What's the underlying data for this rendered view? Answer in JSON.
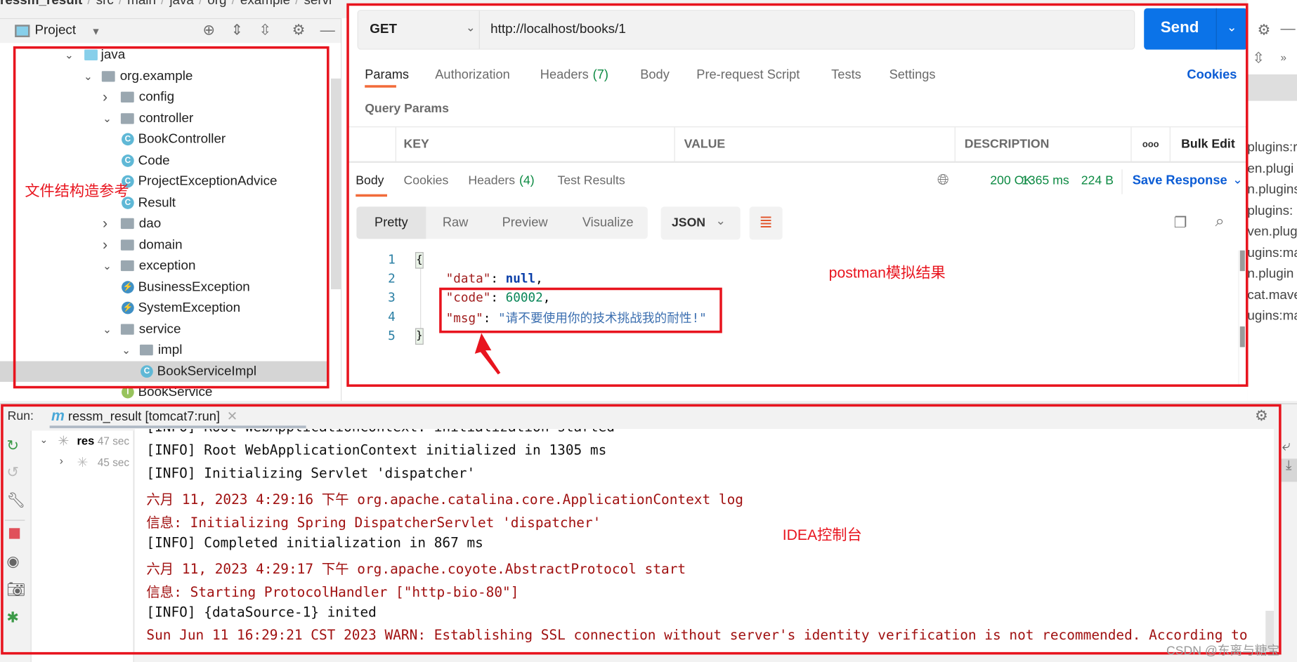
{
  "breadcrumb": [
    "ressm_result",
    "src",
    "main",
    "java",
    "org",
    "example",
    "servi"
  ],
  "project_panel": {
    "title": "Project",
    "tree": [
      {
        "label": "java",
        "type": "source-folder",
        "expanded": true
      },
      {
        "label": "org.example",
        "type": "package",
        "expanded": true
      },
      {
        "label": "config",
        "type": "package",
        "expanded": false
      },
      {
        "label": "controller",
        "type": "package",
        "expanded": true
      },
      {
        "label": "BookController",
        "type": "class"
      },
      {
        "label": "Code",
        "type": "class"
      },
      {
        "label": "ProjectExceptionAdvice",
        "type": "class"
      },
      {
        "label": "Result",
        "type": "class"
      },
      {
        "label": "dao",
        "type": "package",
        "expanded": false
      },
      {
        "label": "domain",
        "type": "package",
        "expanded": false
      },
      {
        "label": "exception",
        "type": "package",
        "expanded": true
      },
      {
        "label": "BusinessException",
        "type": "exception"
      },
      {
        "label": "SystemException",
        "type": "exception"
      },
      {
        "label": "service",
        "type": "package",
        "expanded": true
      },
      {
        "label": "impl",
        "type": "package",
        "expanded": true
      },
      {
        "label": "BookServiceImpl",
        "type": "class",
        "selected": true
      },
      {
        "label": "BookService",
        "type": "interface"
      }
    ]
  },
  "annotations": {
    "tree_note": "文件结构造参考",
    "postman_note": "postman模拟结果",
    "console_note": "IDEA控制台"
  },
  "postman": {
    "method": "GET",
    "url": "http://localhost/books/1",
    "send_label": "Send",
    "request_tabs": [
      {
        "label": "Params",
        "active": true
      },
      {
        "label": "Authorization"
      },
      {
        "label": "Headers",
        "count": "(7)"
      },
      {
        "label": "Body"
      },
      {
        "label": "Pre-request Script"
      },
      {
        "label": "Tests"
      },
      {
        "label": "Settings"
      }
    ],
    "cookies_link": "Cookies",
    "query_params_title": "Query Params",
    "table_headers": {
      "key": "KEY",
      "value": "VALUE",
      "description": "DESCRIPTION",
      "more": "ooo",
      "bulk_edit": "Bulk Edit"
    },
    "response_tabs": [
      {
        "label": "Body",
        "active": true
      },
      {
        "label": "Cookies"
      },
      {
        "label": "Headers",
        "count": "(4)"
      },
      {
        "label": "Test Results"
      }
    ],
    "status": "200 OK",
    "time": "1365 ms",
    "size": "224 B",
    "save_response": "Save Response",
    "view_modes": [
      "Pretty",
      "Raw",
      "Preview",
      "Visualize"
    ],
    "format": "JSON",
    "response_lines": [
      {
        "n": "1",
        "text": "{"
      },
      {
        "n": "2",
        "key": "\"data\"",
        "value": "null",
        "comma": ","
      },
      {
        "n": "3",
        "key": "\"code\"",
        "value": "60002",
        "comma": ","
      },
      {
        "n": "4",
        "key": "\"msg\"",
        "value": "\"请不要使用你的技术挑战我的耐性!\"",
        "comma": ""
      },
      {
        "n": "5",
        "text": "}"
      }
    ]
  },
  "right_strip_text": [
    "plugins:r",
    "en.plugi",
    "n.plugins",
    "plugins:",
    "ven.plug",
    "ugins:ma",
    "n.plugin",
    "cat.mave",
    "ugins:ma"
  ],
  "run_panel": {
    "label": "Run:",
    "tab": "ressm_result [tomcat7:run]",
    "tree": [
      {
        "name": "res",
        "time": "47 sec"
      },
      {
        "time": "45 sec"
      }
    ],
    "console": [
      {
        "text": "[INFO] Root WebApplicationContext: initialization started",
        "level": "info"
      },
      {
        "text": "[INFO] Root WebApplicationContext initialized in 1305 ms",
        "level": "info"
      },
      {
        "text": "[INFO] Initializing Servlet 'dispatcher'",
        "level": "info"
      },
      {
        "text": "六月 11, 2023 4:29:16 下午 org.apache.catalina.core.ApplicationContext log",
        "level": "err"
      },
      {
        "text": "信息: Initializing Spring DispatcherServlet 'dispatcher'",
        "level": "err"
      },
      {
        "text": "[INFO] Completed initialization in 867 ms",
        "level": "info"
      },
      {
        "text": "六月 11, 2023 4:29:17 下午 org.apache.coyote.AbstractProtocol start",
        "level": "err"
      },
      {
        "text": "信息: Starting ProtocolHandler [\"http-bio-80\"]",
        "level": "err"
      },
      {
        "text": "[INFO] {dataSource-1} inited",
        "level": "info"
      },
      {
        "text": "Sun Jun 11 16:29:21 CST 2023 WARN: Establishing SSL connection without server's identity verification is not recommended. According to",
        "level": "err"
      }
    ]
  },
  "watermark": "CSDN @东离与糖宝",
  "colors": {
    "annotation_red": "#e8141e",
    "send_blue": "#0b73e8",
    "tab_accent": "#f26b3a",
    "status_green": "#0d8a43",
    "link_blue": "#0b5cd5",
    "console_red": "#a01010"
  }
}
